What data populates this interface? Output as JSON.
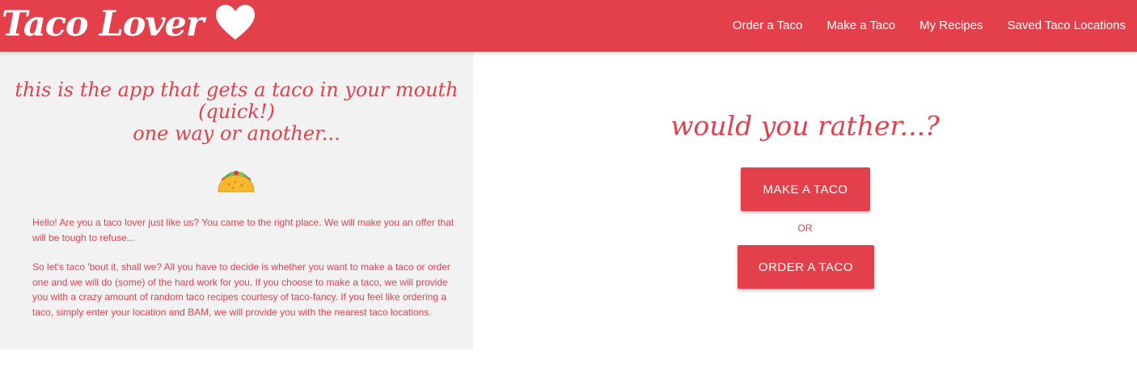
{
  "brand": {
    "name": "Taco Lover",
    "heart_color": "#ffffff"
  },
  "nav": {
    "items": [
      {
        "label": "Order a Taco"
      },
      {
        "label": "Make a Taco"
      },
      {
        "label": "My Recipes"
      },
      {
        "label": "Saved Taco Locations"
      }
    ]
  },
  "intro_panel": {
    "tagline_line1": "this is the app that gets a taco in your mouth",
    "tagline_line2": "(quick!)",
    "tagline_line3": "one way or another...",
    "emoji_icon": "taco-emoji-icon",
    "paragraph1": "Hello! Are you a taco lover just like us? You came to the right place. We will make you an offer that will be tough to refuse...",
    "paragraph2": "So let's taco 'bout it, shall we? All you have to decide is whether you want to make a taco or order one and we will do (some) of the hard work for you. If you choose to make a taco, we will provide you with a crazy amount of random taco recipes courtesy of taco-fancy. If you feel like ordering a taco, simply enter your location and BAM, we will provide you with the nearest taco locations."
  },
  "choice_panel": {
    "question": "would you rather...?",
    "make_button": "MAKE A TACO",
    "or_label": "OR",
    "order_button": "ORDER A TACO"
  },
  "colors": {
    "accent": "#e4404b",
    "panel_bg": "#f2f2f2",
    "text_on_accent": "#ffffff"
  }
}
